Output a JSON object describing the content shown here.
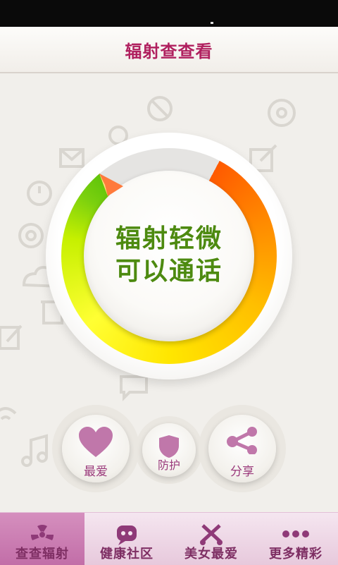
{
  "header": {
    "title": "辐射查查看"
  },
  "meter": {
    "line1": "辐射轻微",
    "line2": "可以通话"
  },
  "actions": [
    {
      "label": "最爱",
      "icon": "heart-icon"
    },
    {
      "label": "防护",
      "icon": "shield-icon"
    },
    {
      "label": "分享",
      "icon": "share-icon"
    }
  ],
  "tabs": [
    {
      "label": "查查辐射",
      "icon": "radiation-icon",
      "active": true
    },
    {
      "label": "健康社区",
      "icon": "chat-bubble-icon",
      "active": false
    },
    {
      "label": "美女最爱",
      "icon": "scissors-icon",
      "active": false
    },
    {
      "label": "更多精彩",
      "icon": "more-dots-icon",
      "active": false
    }
  ],
  "colors": {
    "title": "#b0205f",
    "meter_text": "#4d8a10",
    "action_label": "#9b3b7c",
    "tab_active": "#c26ea8"
  }
}
